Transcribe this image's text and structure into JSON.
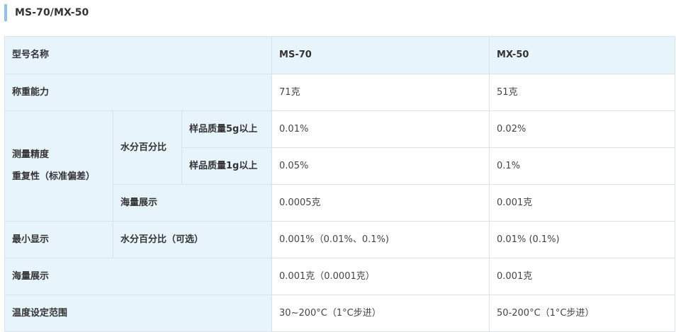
{
  "section": {
    "title": "MS-70/MX-50"
  },
  "table": {
    "header": {
      "label": "型号名称",
      "col1": "MS-70",
      "col2": "MX-50"
    },
    "capacity": {
      "label": "称重能力",
      "ms70": "71克",
      "mx50": "51克"
    },
    "precision": {
      "label_line1": "测量精度",
      "label_line2": "重复性（标准偏差）",
      "moisture_label": "水分百分比",
      "sample5g": {
        "label": "样品质量5g以上",
        "ms70": "0.01%",
        "mx50": "0.02%"
      },
      "sample1g": {
        "label": "样品质量1g以上",
        "ms70": "0.05%",
        "mx50": "0.1%"
      },
      "mass_display": {
        "label": "海量展示",
        "ms70": "0.0005克",
        "mx50": "0.001克"
      }
    },
    "min_display": {
      "label": "最小显示",
      "sub_label": "水分百分比（可选）",
      "ms70": "0.001%（0.01%、0.1%)",
      "mx50": "0.01% (0.1%)"
    },
    "mass_display": {
      "label": "海量展示",
      "ms70": "0.001克（0.0001克）",
      "mx50": "0.001克"
    },
    "temperature": {
      "label": "温度设定范围",
      "ms70": "30~200°C（1°C步进）",
      "mx50": "50-200°C（1°C步进）"
    }
  }
}
